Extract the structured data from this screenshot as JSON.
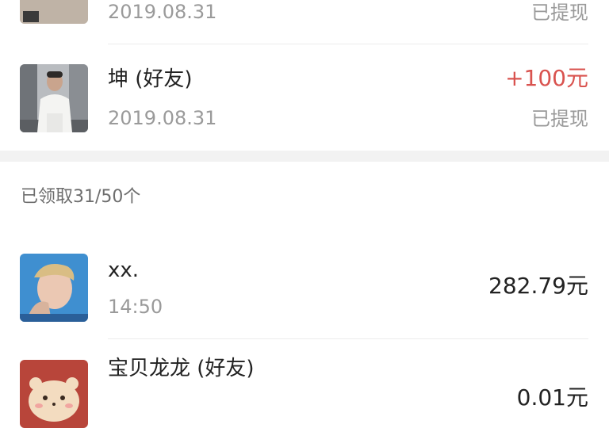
{
  "withdrawn_list": [
    {
      "date": "2019.08.31",
      "status": "已提现"
    },
    {
      "name": "坤 (好友)",
      "date": "2019.08.31",
      "amount": "+100元",
      "status": "已提现"
    }
  ],
  "summary": "已领取31/50个",
  "received_list": [
    {
      "name": "xx.",
      "time": "14:50",
      "amount": "282.79元"
    },
    {
      "name": "宝贝龙龙 (好友)",
      "amount": "0.01元"
    }
  ],
  "colors": {
    "accent_red": "#d9534f",
    "muted": "#9a9a9a",
    "background_gap": "#f2f2f2"
  }
}
